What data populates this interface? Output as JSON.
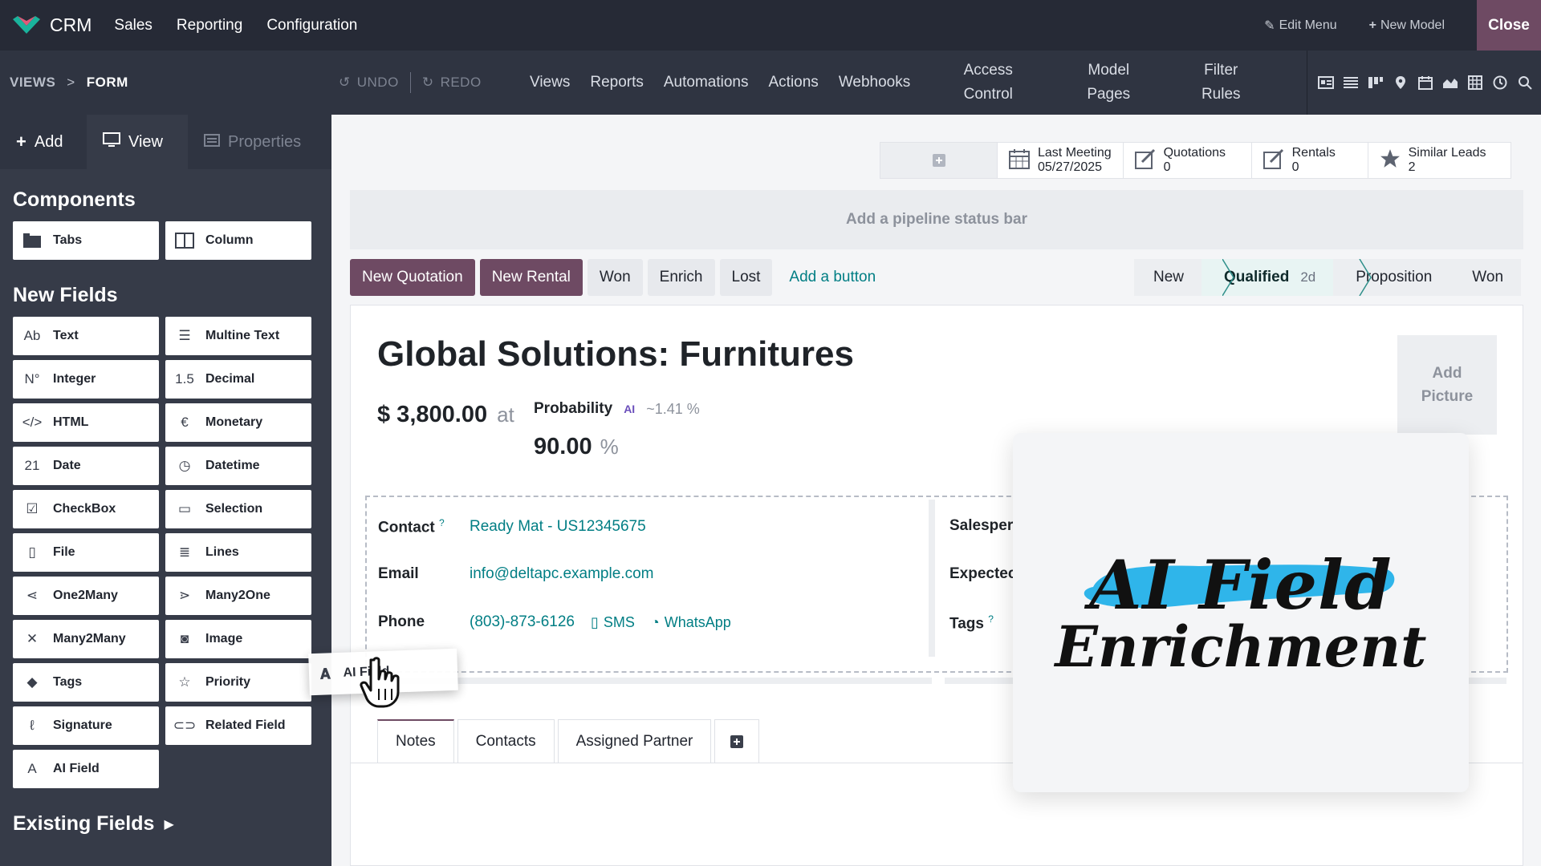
{
  "topbar": {
    "brand": "CRM",
    "menu": [
      "Sales",
      "Reporting",
      "Configuration"
    ],
    "edit_menu": "Edit Menu",
    "new_model": "New Model",
    "close": "Close"
  },
  "subbar": {
    "crumb_root": "VIEWS",
    "crumb_sep": ">",
    "crumb_current": "FORM",
    "undo": "UNDO",
    "redo": "REDO",
    "nav": [
      "Views",
      "Reports",
      "Automations",
      "Actions",
      "Webhooks"
    ],
    "nav_two_line": [
      {
        "l1": "Access",
        "l2": "Control"
      },
      {
        "l1": "Model",
        "l2": "Pages"
      },
      {
        "l1": "Filter",
        "l2": "Rules"
      }
    ],
    "view_icons": [
      "form-view-icon",
      "list-view-icon",
      "kanban-view-icon",
      "map-view-icon",
      "calendar-view-icon",
      "graph-view-icon",
      "pivot-view-icon",
      "activity-view-icon",
      "search-icon"
    ]
  },
  "sidebar": {
    "tabs": {
      "add": "Add",
      "view": "View",
      "properties": "Properties"
    },
    "components_title": "Components",
    "components": [
      {
        "label": "Tabs",
        "icon": "tabs-icon"
      },
      {
        "label": "Column",
        "icon": "columns-icon"
      }
    ],
    "new_fields_title": "New Fields",
    "fields": [
      {
        "label": "Text",
        "icon": "text-icon",
        "glyph": "Ab"
      },
      {
        "label": "Multine Text",
        "icon": "multiline-icon",
        "glyph": "☰"
      },
      {
        "label": "Integer",
        "icon": "integer-icon",
        "glyph": "N°"
      },
      {
        "label": "Decimal",
        "icon": "decimal-icon",
        "glyph": "1.5"
      },
      {
        "label": "HTML",
        "icon": "html-icon",
        "glyph": "</>"
      },
      {
        "label": "Monetary",
        "icon": "monetary-icon",
        "glyph": "€"
      },
      {
        "label": "Date",
        "icon": "date-icon",
        "glyph": "21"
      },
      {
        "label": "Datetime",
        "icon": "datetime-icon",
        "glyph": "◷"
      },
      {
        "label": "CheckBox",
        "icon": "checkbox-icon",
        "glyph": "☑"
      },
      {
        "label": "Selection",
        "icon": "selection-icon",
        "glyph": "▭"
      },
      {
        "label": "File",
        "icon": "file-icon",
        "glyph": "▯"
      },
      {
        "label": "Lines",
        "icon": "lines-icon",
        "glyph": "≣"
      },
      {
        "label": "One2Many",
        "icon": "one2many-icon",
        "glyph": "⋖"
      },
      {
        "label": "Many2One",
        "icon": "many2one-icon",
        "glyph": "⋗"
      },
      {
        "label": "Many2Many",
        "icon": "many2many-icon",
        "glyph": "✕"
      },
      {
        "label": "Image",
        "icon": "image-icon",
        "glyph": "◙"
      },
      {
        "label": "Tags",
        "icon": "tags-icon",
        "glyph": "◆"
      },
      {
        "label": "Priority",
        "icon": "priority-icon",
        "glyph": "☆"
      },
      {
        "label": "Signature",
        "icon": "signature-icon",
        "glyph": "ℓ"
      },
      {
        "label": "Related Field",
        "icon": "related-field-icon",
        "glyph": "⊂⊃"
      },
      {
        "label": "AI Field",
        "icon": "ai-field-icon",
        "glyph": "A"
      }
    ],
    "existing_fields": "Existing Fields"
  },
  "smart_buttons": [
    {
      "label": "Last Meeting",
      "value": "05/27/2025",
      "icon": "calendar-icon"
    },
    {
      "label": "Quotations",
      "value": "0",
      "icon": "edit-icon"
    },
    {
      "label": "Rentals",
      "value": "0",
      "icon": "edit-icon"
    },
    {
      "label": "Similar Leads",
      "value": "2",
      "icon": "star-icon"
    }
  ],
  "status_bar_placeholder": "Add a pipeline status bar",
  "header_buttons": {
    "primary": [
      "New Quotation",
      "New Rental"
    ],
    "secondary": [
      "Won",
      "Enrich",
      "Lost"
    ],
    "add_button": "Add a button"
  },
  "stages": {
    "items": [
      "New",
      "Qualified",
      "Proposition",
      "Won"
    ],
    "active": "Qualified",
    "active_duration": "2d"
  },
  "record": {
    "title": "Global Solutions: Furnitures",
    "revenue": "$ 3,800.00",
    "at": "at",
    "probability_label": "Probability",
    "ai_badge": "AI",
    "automated_probability": "~1.41 %",
    "probability": "90.00",
    "percent": "%",
    "add_picture_l1": "Add",
    "add_picture_l2": "Picture"
  },
  "fields_left": [
    {
      "label": "Contact",
      "value": "Ready Mat - US12345675",
      "help": "?"
    },
    {
      "label": "Email",
      "value": "info@deltapc.example.com"
    },
    {
      "label": "Phone",
      "value": "(803)-873-6126",
      "sms": "SMS",
      "whatsapp": "WhatsApp"
    }
  ],
  "fields_right": [
    {
      "label": "Salesper"
    },
    {
      "label": "Expectec"
    },
    {
      "label": "Tags",
      "help": "?"
    }
  ],
  "notebook_tabs": [
    "Notes",
    "Contacts",
    "Assigned Partner"
  ],
  "drag_ghost": {
    "label": "AI Field",
    "ai_badge": "AI"
  },
  "title_card": {
    "line1": "AI Field",
    "line2": "Enrichment",
    "brush_color": "#2fb5ea"
  },
  "colors": {
    "primary": "#6e4a63",
    "link": "#017e84",
    "nav_bg": "#262a36",
    "sidebar_bg": "#363b48"
  }
}
